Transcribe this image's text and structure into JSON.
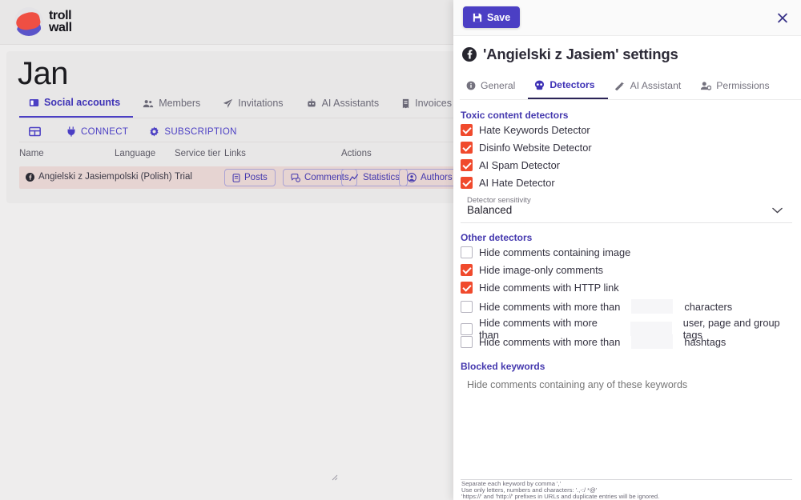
{
  "brand": {
    "name_line1": "troll",
    "name_line2": "wall",
    "logo_icon": "trollwall-logo-icon"
  },
  "workspace": {
    "title": "Jan",
    "tabs": [
      {
        "label": "Social accounts",
        "icon": "window-icon",
        "active": true
      },
      {
        "label": "Members",
        "icon": "people-icon",
        "active": false
      },
      {
        "label": "Invitations",
        "icon": "paper-plane-icon",
        "active": false
      },
      {
        "label": "AI Assistants",
        "icon": "robot-icon",
        "active": false
      },
      {
        "label": "Invoices",
        "icon": "receipt-icon",
        "active": false
      }
    ],
    "subtabs": [
      {
        "label": "",
        "icon": "grid-table-icon"
      },
      {
        "label": "CONNECT",
        "icon": "plug-icon"
      },
      {
        "label": "SUBSCRIPTION",
        "icon": "gear-icon"
      }
    ],
    "table": {
      "columns": [
        "Name",
        "Language",
        "Service tier",
        "Links",
        "Actions"
      ],
      "row": {
        "name": "Angielski z Jasiem",
        "name_icon": "facebook-icon",
        "language": "polski (Polish)",
        "service_tier": "Trial",
        "links": [
          {
            "label": "Posts",
            "icon": "document-icon"
          },
          {
            "label": "Comments",
            "icon": "comments-icon"
          }
        ],
        "actions": [
          {
            "label": "Statistics",
            "icon": "chart-line-icon"
          },
          {
            "label": "Authors",
            "icon": "user-circle-icon"
          }
        ]
      }
    }
  },
  "drawer": {
    "save_label": "Save",
    "save_icon": "floppy-disk-icon",
    "close_icon": "close-icon",
    "title": "'Angielski z Jasiem' settings",
    "title_icon": "facebook-icon",
    "tabs": [
      {
        "label": "General",
        "icon": "info-circle-icon",
        "active": false
      },
      {
        "label": "Detectors",
        "icon": "skull-icon",
        "active": true
      },
      {
        "label": "AI Assistant",
        "icon": "magic-wand-icon",
        "active": false
      },
      {
        "label": "Permissions",
        "icon": "user-gear-icon",
        "active": false
      }
    ],
    "toxic_section": {
      "title": "Toxic content detectors",
      "items": [
        {
          "label": "Hate Keywords Detector",
          "checked": true
        },
        {
          "label": "Disinfo Website Detector",
          "checked": true
        },
        {
          "label": "AI Spam Detector",
          "checked": true
        },
        {
          "label": "AI Hate Detector",
          "checked": true
        }
      ],
      "sensitivity": {
        "label": "Detector sensitivity",
        "value": "Balanced",
        "caret_icon": "chevron-down-icon"
      }
    },
    "other_section": {
      "title": "Other detectors",
      "items": [
        {
          "label": "Hide comments containing image",
          "checked": false,
          "has_input": false,
          "value": "",
          "suffix": ""
        },
        {
          "label": "Hide image-only comments",
          "checked": true,
          "has_input": false,
          "value": "",
          "suffix": ""
        },
        {
          "label": "Hide comments with HTTP link",
          "checked": true,
          "has_input": false,
          "value": "",
          "suffix": ""
        },
        {
          "label": "Hide comments with more than",
          "checked": false,
          "has_input": true,
          "value": "",
          "suffix": "characters"
        },
        {
          "label": "Hide comments with more than",
          "checked": false,
          "has_input": true,
          "value": "",
          "suffix": "user, page and group tags"
        },
        {
          "label": "Hide comments with more than",
          "checked": false,
          "has_input": true,
          "value": "",
          "suffix": "hashtags"
        }
      ]
    },
    "blocked_section": {
      "title": "Blocked keywords",
      "textarea_value": "",
      "textarea_placeholder": "Hide comments containing any of these keywords",
      "helper_line1": "Separate each keyword by comma ','",
      "helper_line2": "Use only letters, numbers and characters: '.,-:/ *@'",
      "helper_line3": "'https://' and 'http://' prefixes in URLs and duplicate entries will be ignored."
    }
  },
  "colors": {
    "accent_purple": "#4b3fc4",
    "checkbox_red": "#f04a2d",
    "row_highlight": "#e6d4d2",
    "page_bg": "#eeeded"
  }
}
